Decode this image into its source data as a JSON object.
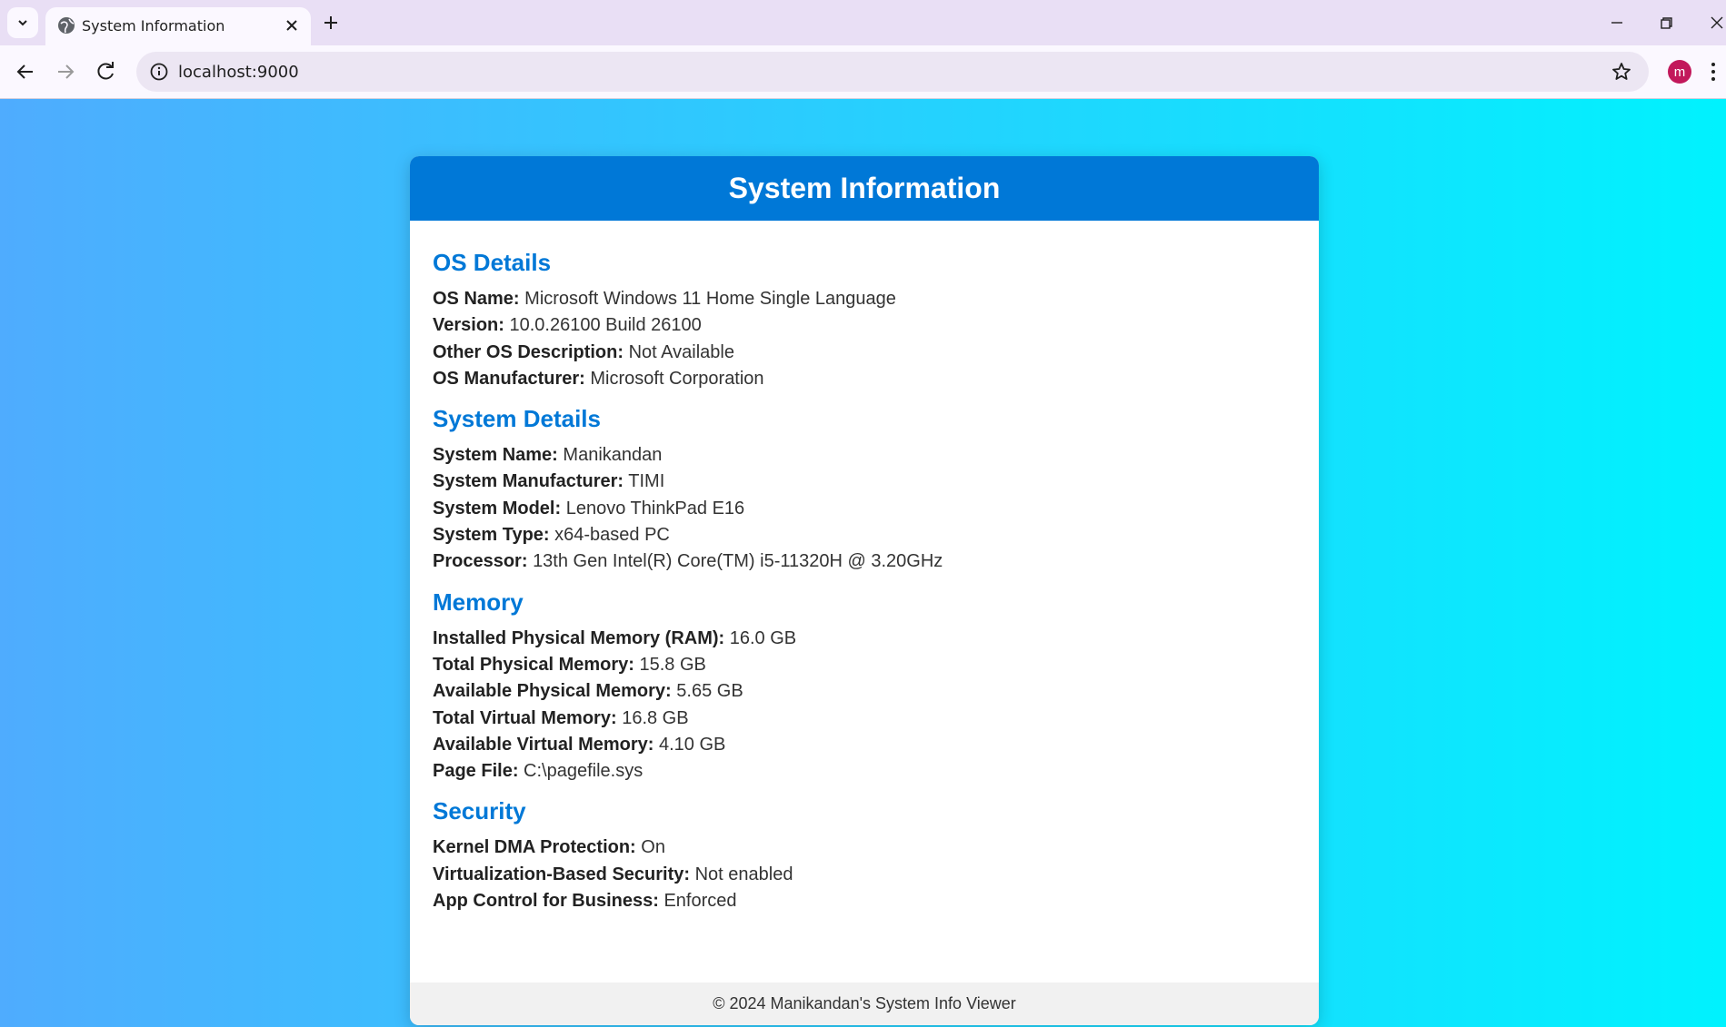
{
  "browser": {
    "tab_title": "System Information",
    "url": "localhost:9000",
    "avatar_letter": "m"
  },
  "page": {
    "title": "System Information",
    "footer": "© 2024 Manikandan's System Info Viewer",
    "sections": [
      {
        "heading": "OS Details",
        "rows": [
          {
            "label": "OS Name:",
            "value": "Microsoft Windows 11 Home Single Language"
          },
          {
            "label": "Version:",
            "value": "10.0.26100 Build 26100"
          },
          {
            "label": "Other OS Description:",
            "value": "Not Available"
          },
          {
            "label": "OS Manufacturer:",
            "value": "Microsoft Corporation"
          }
        ]
      },
      {
        "heading": "System Details",
        "rows": [
          {
            "label": "System Name:",
            "value": "Manikandan"
          },
          {
            "label": "System Manufacturer:",
            "value": "TIMI"
          },
          {
            "label": "System Model:",
            "value": "Lenovo ThinkPad E16"
          },
          {
            "label": "System Type:",
            "value": "x64-based PC"
          },
          {
            "label": "Processor:",
            "value": "13th Gen Intel(R) Core(TM) i5-11320H @ 3.20GHz"
          }
        ]
      },
      {
        "heading": "Memory",
        "rows": [
          {
            "label": "Installed Physical Memory (RAM):",
            "value": "16.0 GB"
          },
          {
            "label": "Total Physical Memory:",
            "value": "15.8 GB"
          },
          {
            "label": "Available Physical Memory:",
            "value": "5.65 GB"
          },
          {
            "label": "Total Virtual Memory:",
            "value": "16.8 GB"
          },
          {
            "label": "Available Virtual Memory:",
            "value": "4.10 GB"
          },
          {
            "label": "Page File:",
            "value": "C:\\pagefile.sys"
          }
        ]
      },
      {
        "heading": "Security",
        "rows": [
          {
            "label": "Kernel DMA Protection:",
            "value": "On"
          },
          {
            "label": "Virtualization-Based Security:",
            "value": "Not enabled"
          },
          {
            "label": "App Control for Business:",
            "value": "Enforced"
          }
        ]
      }
    ]
  },
  "colors": {
    "accent": "#0078d7",
    "gradient_start": "#4facfe",
    "gradient_end": "#00f2fe",
    "avatar": "#c2185b"
  }
}
